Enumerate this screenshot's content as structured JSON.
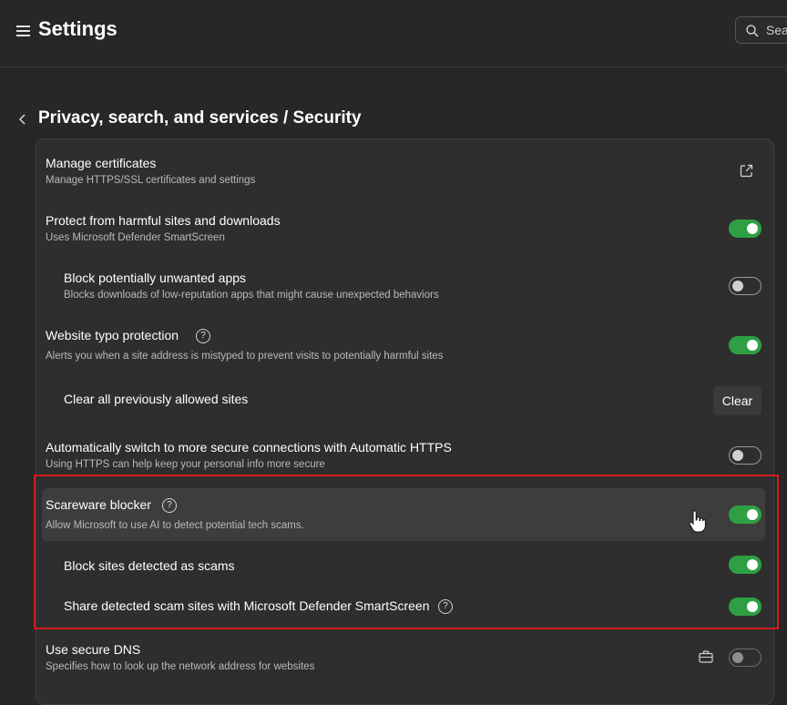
{
  "header": {
    "title": "Settings",
    "search_placeholder": "Search settings"
  },
  "breadcrumb": "Privacy, search, and services / Security",
  "rows": [
    {
      "title": "Manage certificates",
      "subtitle": "Manage HTTPS/SSL certificates and settings",
      "control": "external-link"
    },
    {
      "title": "Protect from harmful sites and downloads",
      "subtitle": "Uses Microsoft Defender SmartScreen",
      "control": "toggle",
      "on": true
    },
    {
      "title": "Block potentially unwanted apps",
      "subtitle": "Blocks downloads of low-reputation apps that might cause unexpected behaviors",
      "control": "toggle",
      "on": false
    },
    {
      "title": "Website typo protection",
      "subtitle": "Alerts you when a site address is mistyped to prevent visits to potentially harmful sites",
      "control": "toggle",
      "on": true
    },
    {
      "title": "Clear all previously allowed sites",
      "control": "button",
      "button_label": "Clear"
    },
    {
      "title": "Automatically switch to more secure connections with Automatic HTTPS",
      "subtitle": "Using HTTPS can help keep your personal info more secure",
      "control": "toggle",
      "on": false
    },
    {
      "title": "Scareware blocker",
      "subtitle": "Allow Microsoft to use AI to detect potential tech scams.",
      "control": "toggle",
      "on": true
    },
    {
      "title": "Block sites detected as scams",
      "control": "toggle",
      "on": true
    },
    {
      "title": "Share detected scam sites with Microsoft Defender SmartScreen",
      "control": "toggle",
      "on": true
    },
    {
      "title": "Use secure DNS",
      "subtitle": "Specifies how to look up the network address for websites",
      "control": "toggle",
      "on": false
    }
  ],
  "colors": {
    "background": "#272727",
    "card": "#2e2e2e",
    "toggle_on": "#2ea043",
    "highlight": "#d01c1c"
  }
}
